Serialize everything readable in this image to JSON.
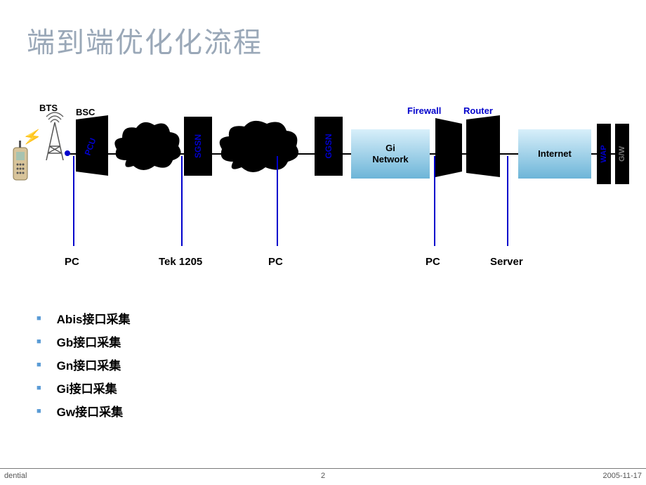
{
  "title": "端到端优化化流程",
  "topLabels": {
    "bts": "BTS",
    "bsc": "BSC",
    "firewall": "Firewall",
    "router": "Router"
  },
  "nodes": {
    "pcu": "PCU",
    "sgsn": "SGSN",
    "ggsn": "GGSN",
    "giNetwork": "Gi\nNetwork",
    "internet": "Internet",
    "wap": "WAP",
    "gw": "G/W"
  },
  "taps": {
    "pc1": "PC",
    "tek": "Tek 1205",
    "pc2": "PC",
    "pc3": "PC",
    "server": "Server"
  },
  "bullets": [
    "Abis接口采集",
    "Gb接口采集",
    "Gn接口采集",
    "Gi接口采集",
    "Gw接口采集"
  ],
  "footer": {
    "left": "dential",
    "center": "2",
    "right": "2005-11-17"
  }
}
